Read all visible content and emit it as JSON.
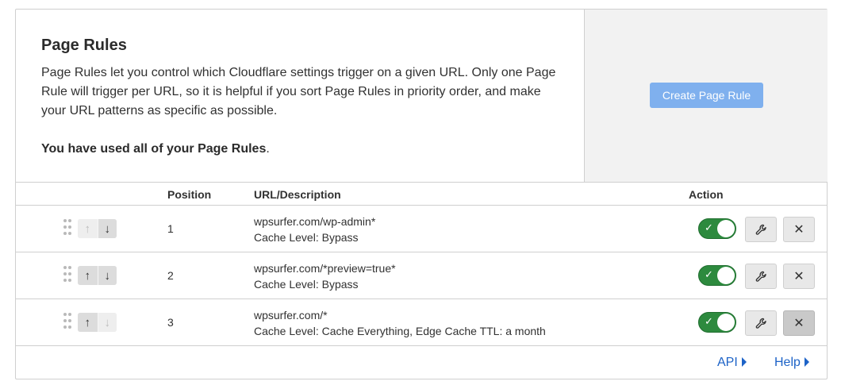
{
  "intro": {
    "title": "Page Rules",
    "description": "Page Rules let you control which Cloudflare settings trigger on a given URL. Only one Page Rule will trigger per URL, so it is helpful if you sort Page Rules in priority order, and make your URL patterns as specific as possible.",
    "note_bold": "You have used all of your Page Rules",
    "note_end": "."
  },
  "create_button": {
    "label": "Create Page Rule",
    "disabled": true
  },
  "table": {
    "headers": {
      "position": "Position",
      "url": "URL/Description",
      "action": "Action"
    },
    "rows": [
      {
        "position": "1",
        "url": "wpsurfer.com/wp-admin*",
        "description": "Cache Level: Bypass",
        "enabled": true,
        "up_enabled": false,
        "down_enabled": true
      },
      {
        "position": "2",
        "url": "wpsurfer.com/*preview=true*",
        "description": "Cache Level: Bypass",
        "enabled": true,
        "up_enabled": true,
        "down_enabled": true
      },
      {
        "position": "3",
        "url": "wpsurfer.com/*",
        "description": "Cache Level: Cache Everything, Edge Cache TTL: a month",
        "enabled": true,
        "up_enabled": true,
        "down_enabled": false
      }
    ]
  },
  "icons": {
    "up": "↑",
    "down": "↓",
    "check": "✓",
    "wrench": "wrench-icon",
    "close": "✕"
  },
  "footer": {
    "api_label": "API",
    "help_label": "Help"
  },
  "colors": {
    "toggle_on": "#2d8a3e",
    "link": "#1d63c7",
    "create_button": "#7fb0ee"
  }
}
